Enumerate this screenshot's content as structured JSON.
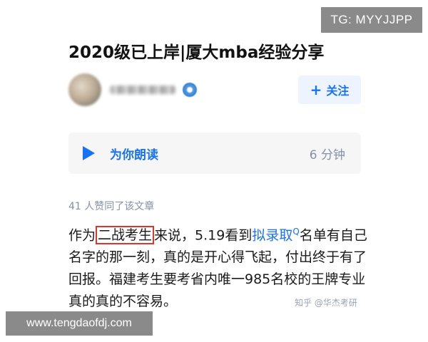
{
  "overlay": {
    "tg_label": "TG: MYYJJPP",
    "url_label": "www.tengdaofdj.com"
  },
  "article": {
    "title": "2020级已上岸|厦大mba经验分享",
    "follow_plus": "+",
    "follow_label": "关注",
    "read_aloud_label": "为你朗读",
    "duration": "6 分钟",
    "likes_text": "41 人赞同了该文章",
    "body": {
      "p1": "作为",
      "boxed": "二战考生",
      "p2": "来说，5.19看到",
      "link": "拟录取",
      "link_sup": "Q",
      "p3": "名单有自己名字的那一刻，真的是开心得飞起，付出终于有了回报。福建考生要考省内唯一985名校的王牌专业真的真的不容易。"
    },
    "watermark": "知乎 @华杰考研"
  },
  "colors": {
    "accent": "#1772f6",
    "highlight_box": "#e0352b",
    "muted": "#8590a6"
  }
}
